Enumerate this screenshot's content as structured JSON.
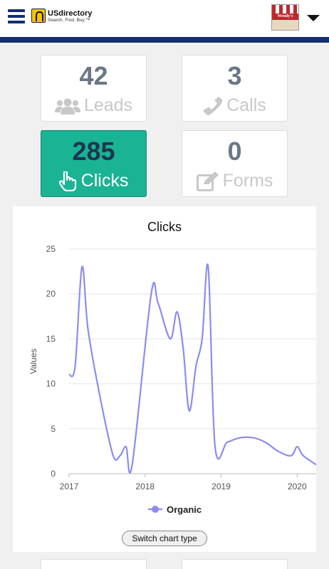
{
  "header": {
    "brand": "USdirectory",
    "tagline": "Search. Find. Buy.™",
    "avatar_sign": "Wendy's"
  },
  "stats": [
    {
      "value": "42",
      "label": "Leads",
      "icon": "users-icon"
    },
    {
      "value": "3",
      "label": "Calls",
      "icon": "phone-icon"
    },
    {
      "value": "285",
      "label": "Clicks",
      "icon": "hand-pointer-icon"
    },
    {
      "value": "0",
      "label": "Forms",
      "icon": "edit-icon"
    }
  ],
  "chart_data": {
    "type": "line",
    "title": "Clicks",
    "ylabel": "Values",
    "xlabel": "",
    "ylim": [
      0,
      25
    ],
    "yticks": [
      "0",
      "5",
      "10",
      "15",
      "20",
      "25"
    ],
    "xticks": [
      "2017",
      "2018",
      "2019",
      "2020"
    ],
    "grid": true,
    "legend": "bottom",
    "series": [
      {
        "name": "Organic",
        "color": "#8c8cf0",
        "points": [
          [
            2017.0,
            11
          ],
          [
            2017.08,
            12
          ],
          [
            2017.17,
            23
          ],
          [
            2017.25,
            16
          ],
          [
            2017.42,
            8
          ],
          [
            2017.58,
            2
          ],
          [
            2017.67,
            2
          ],
          [
            2017.75,
            3
          ],
          [
            2017.83,
            1
          ],
          [
            2018.08,
            20
          ],
          [
            2018.17,
            19
          ],
          [
            2018.33,
            15
          ],
          [
            2018.42,
            18
          ],
          [
            2018.5,
            14
          ],
          [
            2018.58,
            7
          ],
          [
            2018.67,
            12
          ],
          [
            2018.75,
            15
          ],
          [
            2018.83,
            23
          ],
          [
            2018.92,
            3
          ],
          [
            2019.08,
            3.5
          ],
          [
            2019.25,
            4
          ],
          [
            2019.42,
            4
          ],
          [
            2019.58,
            3.5
          ],
          [
            2019.75,
            2.5
          ],
          [
            2019.92,
            2
          ],
          [
            2020.0,
            3
          ],
          [
            2020.08,
            2
          ],
          [
            2020.25,
            1
          ]
        ]
      }
    ]
  },
  "switch_label": "Switch chart type"
}
